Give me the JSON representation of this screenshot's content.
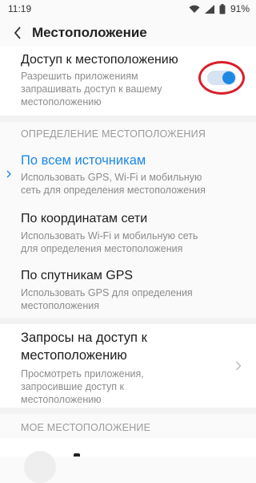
{
  "status_bar": {
    "time": "11:19",
    "battery": "91%"
  },
  "app_bar": {
    "title": "Местоположение"
  },
  "location_access": {
    "title": "Доступ к местоположению",
    "subtitle_line1": "Разрешить приложениям",
    "subtitle_line2": "запрашивать доступ к вашему",
    "subtitle_line3": "местоположению",
    "toggle_on": true
  },
  "section_detection": {
    "header": "ОПРЕДЕЛЕНИЕ МЕСТОПОЛОЖЕНИЯ"
  },
  "modes": [
    {
      "title": "По всем источникам",
      "sub1": "Использовать GPS, Wi-Fi и мобильную",
      "sub2": "сеть для определения местоположения",
      "selected": true
    },
    {
      "title": "По координатам сети",
      "sub1": "Использовать Wi-Fi и мобильную сеть",
      "sub2": "для определения местоположения",
      "selected": false
    },
    {
      "title": "По спутникам GPS",
      "sub1": "Использовать GPS для определения",
      "sub2": "местоположения",
      "selected": false
    }
  ],
  "requests": {
    "title_line1": "Запросы на доступ к",
    "title_line2": "местоположению",
    "sub1": "Просмотреть приложения,",
    "sub2": "запросившие доступ к",
    "sub3": "местоположению"
  },
  "section_my_location": {
    "header": "МОЕ МЕСТОПОЛОЖЕНИЕ"
  },
  "colors": {
    "accent": "#1e88e5",
    "highlight_circle": "#d81f2a"
  }
}
